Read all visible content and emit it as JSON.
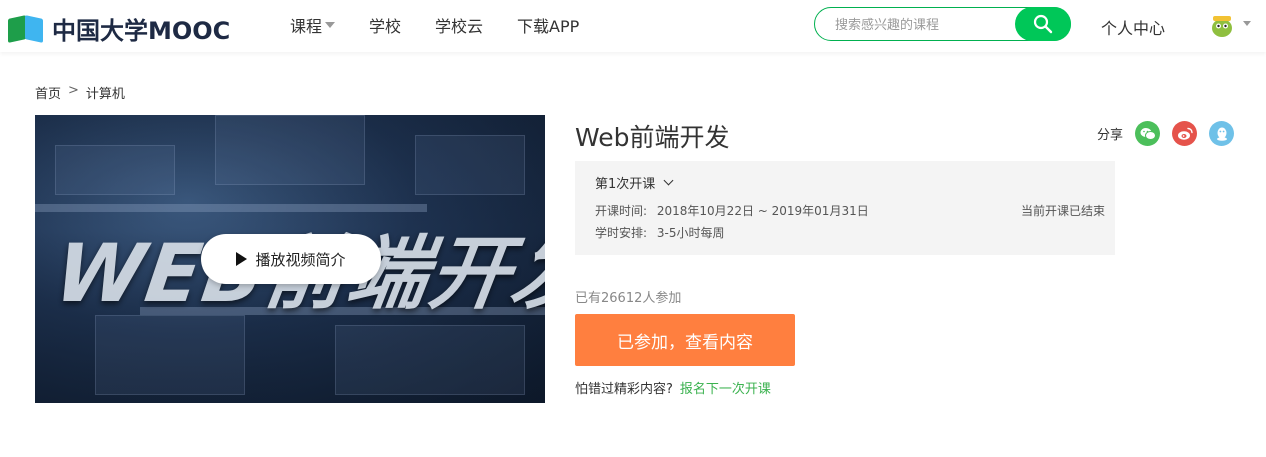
{
  "header": {
    "logo_text": "中国大学MOOC",
    "nav": [
      {
        "label": "课程",
        "has_caret": true
      },
      {
        "label": "学校",
        "has_caret": false
      },
      {
        "label": "学校云",
        "has_caret": false
      },
      {
        "label": "下载APP",
        "has_caret": false
      }
    ],
    "search": {
      "placeholder": "搜索感兴趣的课程",
      "value": ""
    },
    "personal_center": "个人中心"
  },
  "breadcrumb": {
    "home": "首页",
    "separator": ">",
    "category": "计算机"
  },
  "video": {
    "cover_text": "WEB前端开发",
    "play_label": "播放视频简介"
  },
  "course": {
    "title": "Web前端开发",
    "share_label": "分享",
    "share_icons": [
      "wechat-icon",
      "weibo-icon",
      "qq-icon"
    ],
    "term": {
      "selected": "第1次开课",
      "time_label": "开课时间:",
      "time_value": "2018年10月22日 ~ 2019年01月31日",
      "hours_label": "学时安排:",
      "hours_value": "3-5小时每周",
      "status": "当前开课已结束"
    },
    "enroll_count": "已有26612人参加",
    "enroll_button": "已参加，查看内容",
    "miss_text": "怕错过精彩内容?",
    "miss_link": "报名下一次开课"
  },
  "colors": {
    "brand_green": "#00c758",
    "accent_orange": "#ff7f3f",
    "link_green": "#3bb24f",
    "wechat": "#4cbf5b",
    "weibo": "#e5534b",
    "qq": "#6fc1e8"
  }
}
